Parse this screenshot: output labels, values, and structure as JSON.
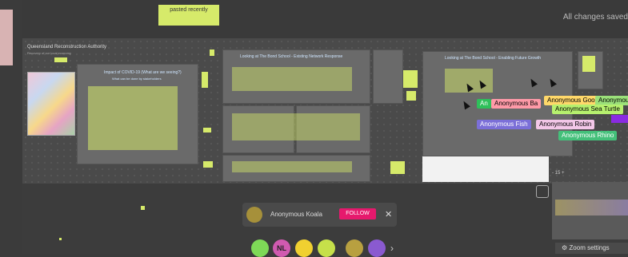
{
  "top_sticky": "pasted recently",
  "status": "All changes saved",
  "board": {
    "title": "Queensland Reconstruction Authority",
    "subtitle": "Recovery of our local economy",
    "p1_title": "Impact of COVID-19 (What are we seeing?)",
    "p1_sub": "What can be done by stakeholders",
    "p2_title": "Looking at The Bond School - Existing Network Response",
    "p3_title": "Looking at The Bond School - Enabling Future Growth"
  },
  "collaborators": [
    {
      "name": "Anonymous Goo",
      "color": "#ffd86a"
    },
    {
      "name": "Anonymous Rhino",
      "color": "#9be07a"
    },
    {
      "name": "Anonymous Ba",
      "color": "#ff9aa8"
    },
    {
      "name": "Anonymous Sea Turtle",
      "color": "#b6f06e"
    },
    {
      "name": "An",
      "color": "#2ec05a"
    },
    {
      "name": "Anonymous Fish",
      "color": "#7b6fd8"
    },
    {
      "name": "Anonymous Robin",
      "color": "#f3c7e8"
    },
    {
      "name": "Anonymous Rhino",
      "color": "#44c07a"
    }
  ],
  "follow_bar": {
    "name": "Anonymous Koala",
    "follow_label": "FOLLOW",
    "close": "✕"
  },
  "avatars": [
    {
      "label": "",
      "color": "#7ed957"
    },
    {
      "label": "NL",
      "color": "#d05ab0"
    },
    {
      "label": "",
      "color": "#f0d030"
    },
    {
      "label": "",
      "color": "#c6e04a"
    },
    {
      "label": "",
      "color": "#b8a040"
    },
    {
      "label": "",
      "color": "#8a5ad0"
    }
  ],
  "more_chevron": "›",
  "zoom_label": "Zoom settings",
  "minimap_zoom": "- 15 +"
}
